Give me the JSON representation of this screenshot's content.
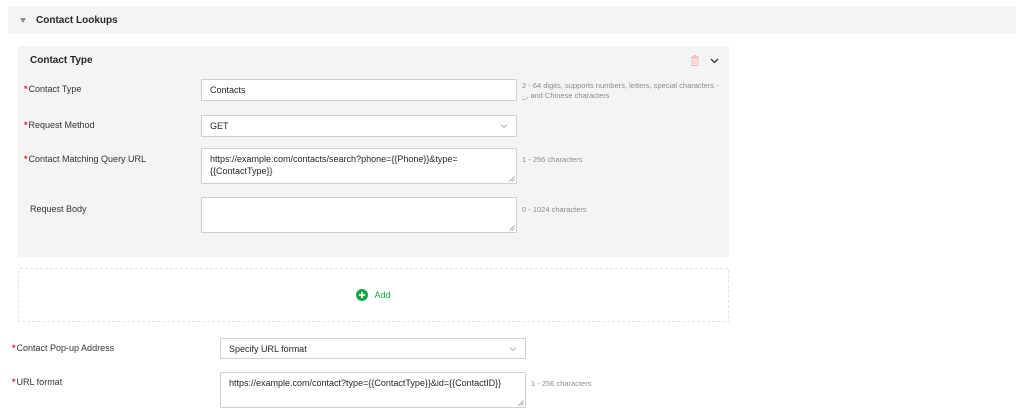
{
  "section": {
    "title": "Contact Lookups",
    "icon": "caret-down-icon"
  },
  "card": {
    "title": "Contact Type",
    "delete_icon": "trash-icon",
    "collapse_icon": "chevron-down-icon",
    "fields": {
      "contact_type": {
        "label": "Contact Type",
        "required": true,
        "value": "Contacts",
        "hint_line1": "2 - 64 digits, supports numbers, letters, special characters -",
        "hint_line2": "_, and Chinese characters"
      },
      "request_method": {
        "label": "Request Method",
        "required": true,
        "value": "GET"
      },
      "matching_url": {
        "label": "Contact Matching Query URL",
        "required": true,
        "value_line1": "https://example.com/contacts/search?phone={{Phone}}&type=",
        "value_line2": "{{ContactType}}",
        "hint": "1 - 256 characters"
      },
      "request_body": {
        "label": "Request Body",
        "required": false,
        "value": "",
        "hint": "0 - 1024 characters"
      }
    }
  },
  "add": {
    "label": "Add",
    "icon": "plus-circle-icon"
  },
  "popup": {
    "label": "Contact Pop-up Address",
    "required": true,
    "value": "Specify URL format"
  },
  "url_format": {
    "label": "URL format",
    "required": true,
    "value": "https://example.com/contact?type={{ContactType}}&id={{ContactID}}",
    "hint": "1 - 256 characters"
  },
  "colors": {
    "required": "#e02424",
    "accent": "#16a34a",
    "panel": "#f4f4f5"
  },
  "required_mark": "*"
}
